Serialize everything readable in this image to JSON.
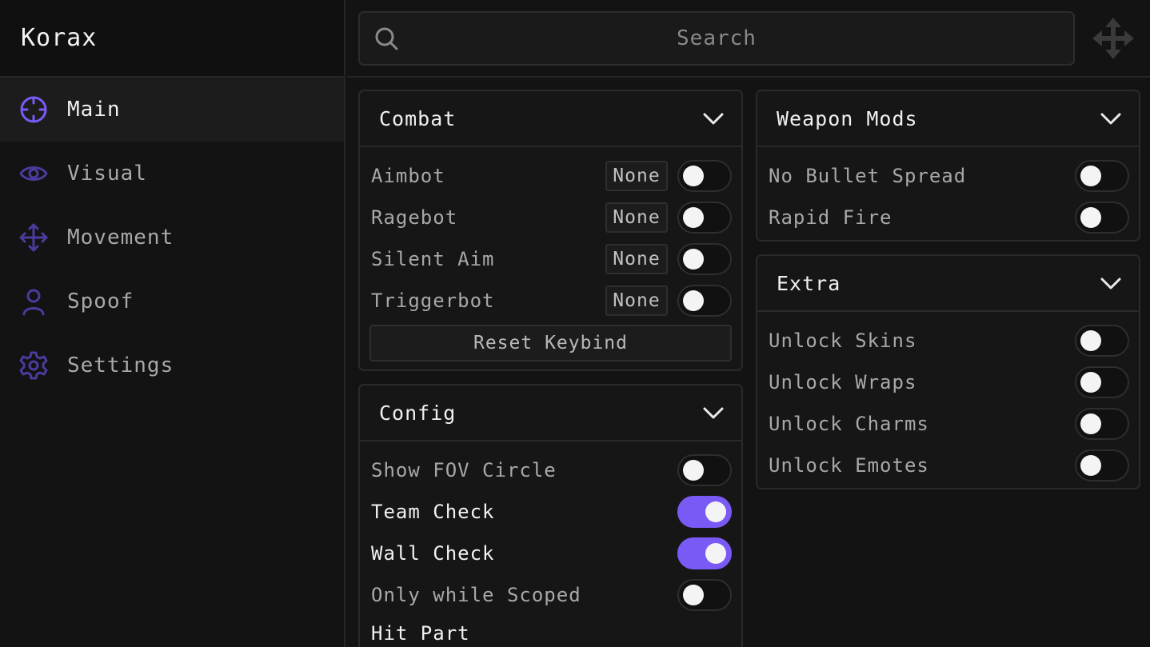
{
  "app": {
    "title": "Korax",
    "accent_color": "#7a5af5"
  },
  "sidebar": {
    "items": [
      {
        "label": "Main",
        "icon": "crosshair-icon",
        "active": true
      },
      {
        "label": "Visual",
        "icon": "eye-icon",
        "active": false
      },
      {
        "label": "Movement",
        "icon": "move-arrows-icon",
        "active": false
      },
      {
        "label": "Spoof",
        "icon": "user-icon",
        "active": false
      },
      {
        "label": "Settings",
        "icon": "gear-icon",
        "active": false
      }
    ]
  },
  "search": {
    "placeholder": "Search"
  },
  "panels": {
    "combat": {
      "title": "Combat",
      "rows": [
        {
          "label": "Aimbot",
          "keybind": "None",
          "enabled": false
        },
        {
          "label": "Ragebot",
          "keybind": "None",
          "enabled": false
        },
        {
          "label": "Silent Aim",
          "keybind": "None",
          "enabled": false
        },
        {
          "label": "Triggerbot",
          "keybind": "None",
          "enabled": false
        }
      ],
      "reset_label": "Reset Keybind"
    },
    "config": {
      "title": "Config",
      "rows": [
        {
          "label": "Show FOV Circle",
          "enabled": false
        },
        {
          "label": "Team Check",
          "enabled": true
        },
        {
          "label": "Wall Check",
          "enabled": true
        },
        {
          "label": "Only while Scoped",
          "enabled": false
        }
      ],
      "hit_part_label": "Hit Part"
    },
    "weapon_mods": {
      "title": "Weapon Mods",
      "rows": [
        {
          "label": "No Bullet Spread",
          "enabled": false
        },
        {
          "label": "Rapid Fire",
          "enabled": false
        }
      ]
    },
    "extra": {
      "title": "Extra",
      "rows": [
        {
          "label": "Unlock Skins",
          "enabled": false
        },
        {
          "label": "Unlock Wraps",
          "enabled": false
        },
        {
          "label": "Unlock Charms",
          "enabled": false
        },
        {
          "label": "Unlock Emotes",
          "enabled": false
        }
      ]
    }
  }
}
